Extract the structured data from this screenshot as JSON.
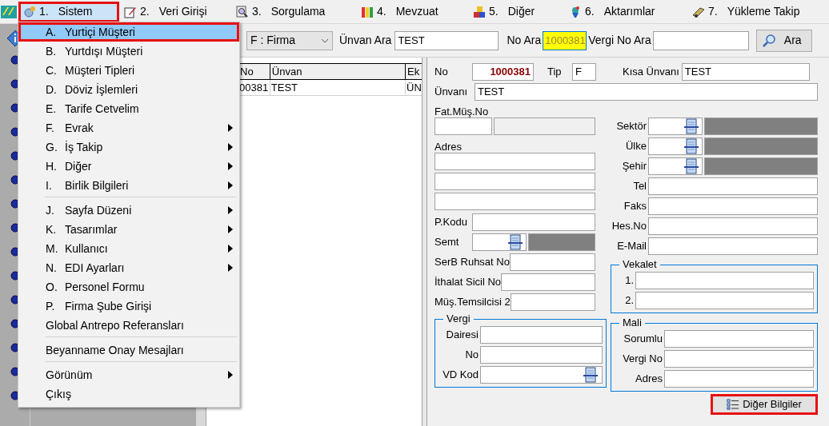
{
  "menubar": [
    {
      "number": "1.",
      "label": "Sistem",
      "selected": true
    },
    {
      "number": "2.",
      "label": "Veri Girişi",
      "selected": false
    },
    {
      "number": "3.",
      "label": "Sorgulama",
      "selected": false
    },
    {
      "number": "4.",
      "label": "Mevzuat",
      "selected": false
    },
    {
      "number": "5.",
      "label": "Diğer",
      "selected": false
    },
    {
      "number": "6.",
      "label": "Aktarımlar",
      "selected": false
    },
    {
      "number": "7.",
      "label": "Yükleme Takip",
      "selected": false
    }
  ],
  "sistem_menu": [
    {
      "key": "A.",
      "label": "Yurtiçi Müşteri",
      "selected": true,
      "has_submenu": false,
      "separator_after": false
    },
    {
      "key": "B.",
      "label": "Yurtdışı Müşteri",
      "selected": false,
      "has_submenu": false,
      "separator_after": false
    },
    {
      "key": "C.",
      "label": "Müşteri Tipleri",
      "selected": false,
      "has_submenu": false,
      "separator_after": false
    },
    {
      "key": "D.",
      "label": "Döviz İşlemleri",
      "selected": false,
      "has_submenu": false,
      "separator_after": false
    },
    {
      "key": "E.",
      "label": "Tarife Cetvelim",
      "selected": false,
      "has_submenu": false,
      "separator_after": false
    },
    {
      "key": "F.",
      "label": "Evrak",
      "selected": false,
      "has_submenu": true,
      "separator_after": false
    },
    {
      "key": "G.",
      "label": "İş Takip",
      "selected": false,
      "has_submenu": true,
      "separator_after": false
    },
    {
      "key": "H.",
      "label": "Diğer",
      "selected": false,
      "has_submenu": true,
      "separator_after": false
    },
    {
      "key": "I.",
      "label": "Birlik Bilgileri",
      "selected": false,
      "has_submenu": true,
      "separator_after": true
    },
    {
      "key": "J.",
      "label": "Sayfa Düzeni",
      "selected": false,
      "has_submenu": true,
      "separator_after": false
    },
    {
      "key": "K.",
      "label": "Tasarımlar",
      "selected": false,
      "has_submenu": true,
      "separator_after": false
    },
    {
      "key": "M.",
      "label": "Kullanıcı",
      "selected": false,
      "has_submenu": true,
      "separator_after": false
    },
    {
      "key": "N.",
      "label": "EDI Ayarları",
      "selected": false,
      "has_submenu": true,
      "separator_after": false
    },
    {
      "key": "O.",
      "label": "Personel Formu",
      "selected": false,
      "has_submenu": false,
      "separator_after": false
    },
    {
      "key": "P.",
      "label": "Firma Şube Girişi",
      "selected": false,
      "has_submenu": false,
      "separator_after": false
    },
    {
      "label": "Global Antrepo Referansları",
      "selected": false,
      "has_submenu": false,
      "separator_after": true
    },
    {
      "label": "Beyanname Onay Mesajları",
      "selected": false,
      "has_submenu": false,
      "separator_after": true
    },
    {
      "label": "Görünüm",
      "selected": false,
      "has_submenu": true,
      "separator_after": false
    },
    {
      "label": "Çıkış",
      "selected": false,
      "has_submenu": false,
      "separator_after": false
    }
  ],
  "toolbar": {
    "type_combo": "F : Firma",
    "unvan_label": "Ünvan Ara",
    "unvan_value": "TEST",
    "no_label": "No Ara",
    "no_value": "1000381",
    "vergi_label": "Vergi No Ara",
    "search_button": "Ara"
  },
  "list": {
    "columns": [
      "No",
      "Ünvan",
      "Ek"
    ],
    "rows": [
      [
        "00381",
        "TEST",
        "ÜN"
      ]
    ]
  },
  "form": {
    "no_label": "No",
    "no_value": "1000381",
    "tip_label": "Tip",
    "tip_value": "F",
    "kisa_label": "Kısa Ünvanı",
    "kisa_value": "TEST",
    "unvan_label": "Ünvanı",
    "unvan_value": "TEST",
    "fat_label": "Fat.Müş.No",
    "adres_label": "Adres",
    "left_fields": [
      {
        "label": "P.Kodu",
        "kind": "text"
      },
      {
        "label": "Semt",
        "kind": "lookup"
      },
      {
        "label": "SerB Ruhsat No",
        "kind": "text"
      },
      {
        "label": "İthalat Sicil No",
        "kind": "text"
      },
      {
        "label": "Müş.Temsilcisi 2",
        "kind": "text"
      }
    ],
    "right_fields": [
      {
        "label": "Sektör",
        "kind": "lookup"
      },
      {
        "label": "Ülke",
        "kind": "lookup"
      },
      {
        "label": "Şehir",
        "kind": "lookup"
      },
      {
        "label": "Tel",
        "kind": "text"
      },
      {
        "label": "Faks",
        "kind": "text"
      },
      {
        "label": "Hes.No",
        "kind": "text"
      },
      {
        "label": "E-Mail",
        "kind": "text"
      }
    ],
    "vergi": {
      "title": "Vergi",
      "fields": [
        {
          "label": "Dairesi",
          "kind": "text"
        },
        {
          "label": "No",
          "kind": "text"
        },
        {
          "label": "VD Kod",
          "kind": "code"
        }
      ]
    },
    "vekalet": {
      "title": "Vekalet",
      "fields": [
        {
          "label": "1.",
          "kind": "text"
        },
        {
          "label": "2.",
          "kind": "text"
        }
      ]
    },
    "mali": {
      "title": "Mali",
      "fields": [
        {
          "label": "Sorumlu",
          "kind": "text"
        },
        {
          "label": "Vergi No",
          "kind": "text"
        },
        {
          "label": "Adres",
          "kind": "text"
        }
      ]
    },
    "other_button": "Diğer Bilgiler"
  }
}
